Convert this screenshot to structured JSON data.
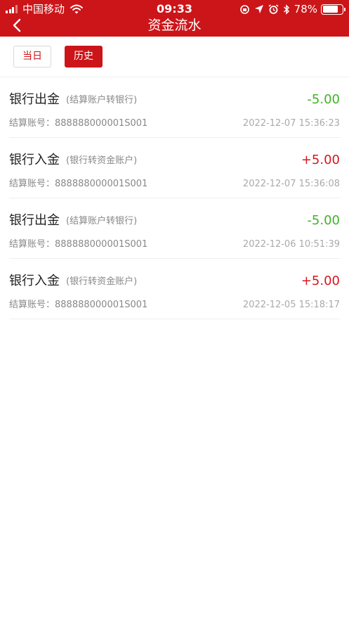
{
  "status_bar": {
    "carrier": "中国移动",
    "time": "09:33",
    "battery": "78%",
    "battery_level": 0.78
  },
  "header": {
    "title": "资金流水",
    "back_icon": "chevron-left-icon"
  },
  "tabs": [
    {
      "label": "当日",
      "active": false
    },
    {
      "label": "历史",
      "active": true
    }
  ],
  "records": [
    {
      "title": "银行出金",
      "subtitle": "(结算账户转银行)",
      "amount": "-5.00",
      "type": "out",
      "account_label": "结算账号：",
      "account": "888888000001S001",
      "time": "2022-12-07 15:36:23"
    },
    {
      "title": "银行入金",
      "subtitle": "(银行转资金账户)",
      "amount": "+5.00",
      "type": "in",
      "account_label": "结算账号：",
      "account": "888888000001S001",
      "time": "2022-12-07 15:36:08"
    },
    {
      "title": "银行出金",
      "subtitle": "(结算账户转银行)",
      "amount": "-5.00",
      "type": "out",
      "account_label": "结算账号：",
      "account": "888888000001S001",
      "time": "2022-12-06 10:51:39"
    },
    {
      "title": "银行入金",
      "subtitle": "(银行转资金账户)",
      "amount": "+5.00",
      "type": "in",
      "account_label": "结算账号：",
      "account": "888888000001S001",
      "time": "2022-12-05 15:18:17"
    }
  ],
  "colors": {
    "brand_red": "#cc1519",
    "amount_out": "#3fb325",
    "amount_in": "#d7161c"
  }
}
